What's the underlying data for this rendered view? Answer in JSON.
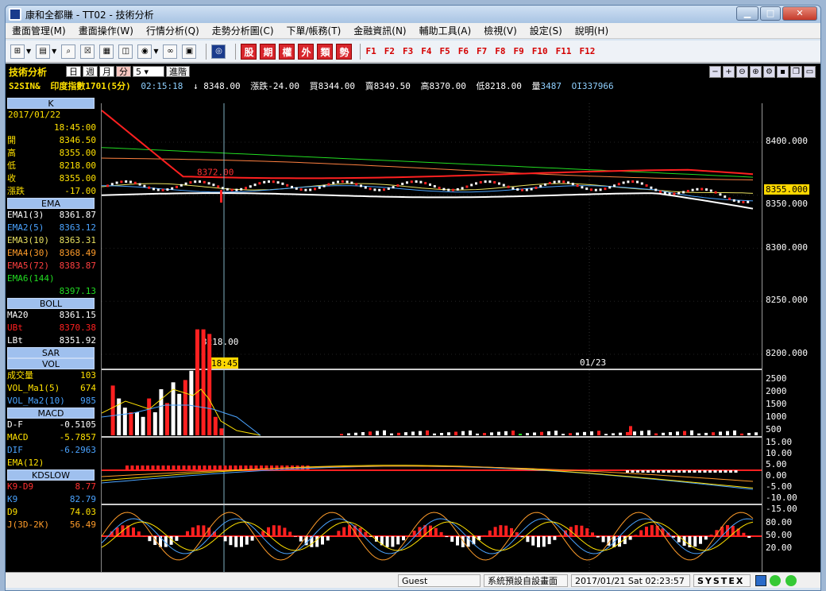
{
  "window": {
    "title": "康和全都賺 - TT02 - 技術分析"
  },
  "menu": [
    "畫面管理(M)",
    "畫面操作(W)",
    "行情分析(Q)",
    "走勢分析圖(C)",
    "下單/帳務(T)",
    "金融資訊(N)",
    "輔助工具(A)",
    "檢視(V)",
    "設定(S)",
    "說明(H)"
  ],
  "toolbar": {
    "red_buttons": [
      "股",
      "期",
      "權",
      "外",
      "類",
      "勢"
    ],
    "fkeys": [
      "F1",
      "F2",
      "F3",
      "F4",
      "F5",
      "F6",
      "F7",
      "F8",
      "F9",
      "F10",
      "F11",
      "F12"
    ]
  },
  "panel": {
    "title": "技術分析",
    "periods": [
      "日",
      "週",
      "月",
      "分"
    ],
    "interval": "5",
    "advanced": "進階",
    "quote": {
      "symbol": "S2SIN&",
      "name": "印度指數1701(5分)",
      "time": "02:15:18",
      "arrow": "↓",
      "last": "8348.00",
      "chg_label": "漲跌",
      "chg": "-24.00",
      "bid_label": "買",
      "bid": "8344.00",
      "ask_label": "賣",
      "ask": "8349.50",
      "high_label": "高",
      "high": "8370.00",
      "low_label": "低",
      "low": "8218.00",
      "vol_label": "量",
      "vol": "3487",
      "oi_label": "OI",
      "oi": "337966"
    }
  },
  "left": {
    "k": {
      "title": "K",
      "date": "2017/01/22",
      "time": "18:45:00",
      "rows": [
        {
          "l": "開",
          "v": "8346.50"
        },
        {
          "l": "高",
          "v": "8355.00"
        },
        {
          "l": "低",
          "v": "8218.00"
        },
        {
          "l": "收",
          "v": "8355.00"
        },
        {
          "l": "漲跌",
          "v": "-17.00"
        }
      ]
    },
    "ema": {
      "title": "EMA",
      "rows": [
        {
          "l": "EMA1(3)",
          "v": "8361.87",
          "c": "#ffffff"
        },
        {
          "l": "EMA2(5)",
          "v": "8363.12",
          "c": "#4aa3ff"
        },
        {
          "l": "EMA3(10)",
          "v": "8363.31",
          "c": "#e8e060"
        },
        {
          "l": "EMA4(30)",
          "v": "8368.49",
          "c": "#ff9c2a"
        },
        {
          "l": "EMA5(72)",
          "v": "8383.87",
          "c": "#ff4040"
        },
        {
          "l": "EMA6(144)",
          "v": "8397.13",
          "c": "#22dd22"
        }
      ]
    },
    "boll": {
      "title": "BOLL",
      "rows": [
        {
          "l": "MA20",
          "v": "8361.15",
          "c": "#ffffff"
        },
        {
          "l": "UBt",
          "v": "8370.38",
          "c": "#ff2020"
        },
        {
          "l": "LBt",
          "v": "8351.92",
          "c": "#ffffff"
        }
      ]
    },
    "sar": {
      "title": "SAR"
    },
    "vol": {
      "title": "VOL",
      "rows": [
        {
          "l": "成交量",
          "v": "103",
          "c": "#ffe100"
        },
        {
          "l": "VOL_Ma1(5)",
          "v": "674",
          "c": "#ffe100"
        },
        {
          "l": "VOL_Ma2(10)",
          "v": "985",
          "c": "#4aa3ff"
        }
      ]
    },
    "macd": {
      "title": "MACD",
      "rows": [
        {
          "l": "D-F",
          "v": "-0.5105",
          "c": "#ffffff"
        },
        {
          "l": "MACD",
          "v": "-5.7857",
          "c": "#ffe100"
        },
        {
          "l": "DIF",
          "v": "-6.2963",
          "c": "#4aa3ff"
        },
        {
          "l": "EMA(12)",
          "v": "",
          "c": "#ffe100"
        }
      ]
    },
    "kd": {
      "title": "KDSLOW",
      "rows": [
        {
          "l": "K9-D9",
          "v": "8.77",
          "c": "#ff3030"
        },
        {
          "l": "K9",
          "v": "82.79",
          "c": "#4aa3ff"
        },
        {
          "l": "D9",
          "v": "74.03",
          "c": "#ffe100"
        },
        {
          "l": "J(3D-2K)",
          "v": "56.49",
          "c": "#ff9c2a"
        }
      ]
    }
  },
  "chart": {
    "price_ticks": [
      "8400.000",
      "8350.000",
      "8300.000",
      "8250.000",
      "8200.000"
    ],
    "current": "8355.000",
    "high_mark": "8372.00",
    "low_mark": "8218.00",
    "cursor_time": "18:45",
    "date_label": "01/23",
    "vol_ticks": [
      "2500",
      "2000",
      "1500",
      "1000",
      "500"
    ],
    "macd_ticks": [
      "15.00",
      "10.00",
      "5.00",
      "0.00",
      "-5.00",
      "-10.00",
      "-15.00"
    ],
    "kd_ticks": [
      "80.00",
      "50.00",
      "20.00"
    ]
  },
  "status": {
    "user": "Guest",
    "screen": "系統預設自設畫面",
    "datetime": "2017/01/21 Sat 02:23:57",
    "brand": "SYSTEX"
  }
}
